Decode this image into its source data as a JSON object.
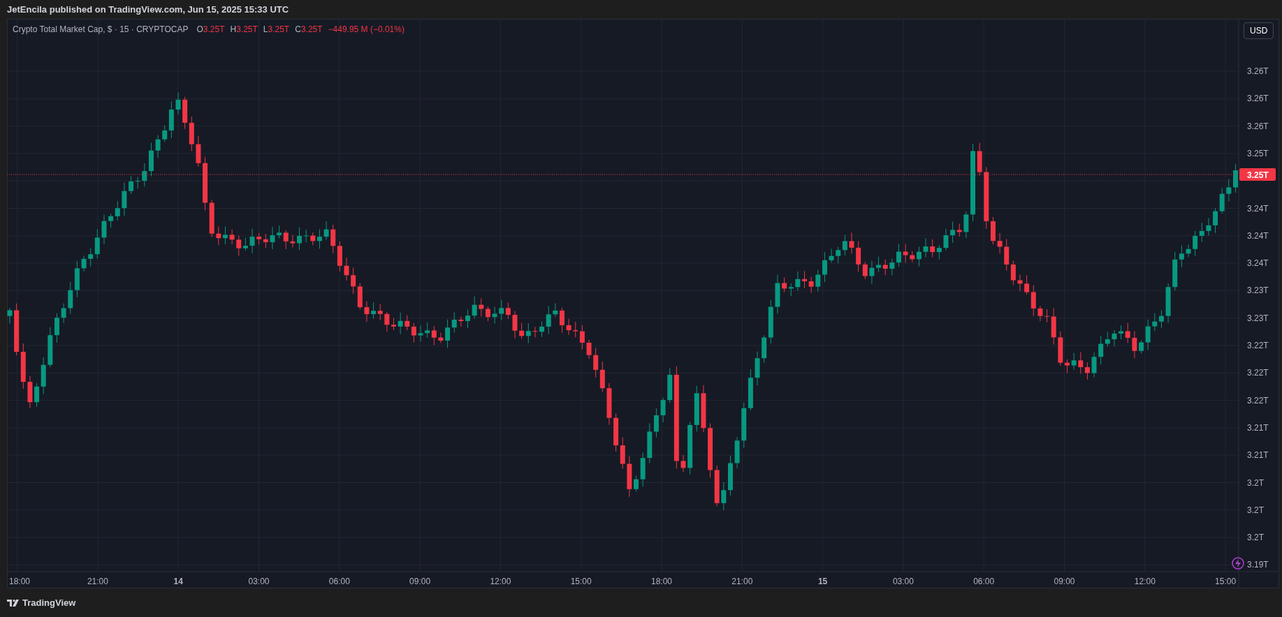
{
  "header": {
    "text": "JetEncila published on TradingView.com, Jun 15, 2025 15:33 UTC"
  },
  "legend": {
    "title": "Crypto Total Market Cap, $ · 15 · CRYPTOCAP",
    "ohlc": [
      {
        "label": "O",
        "value": "3.25T"
      },
      {
        "label": "H",
        "value": "3.25T"
      },
      {
        "label": "L",
        "value": "3.25T"
      },
      {
        "label": "C",
        "value": "3.25T"
      }
    ],
    "change": "−449.95 M (−0.01%)"
  },
  "currency_button": "USD",
  "price_axis": {
    "labels": [
      "3.26T",
      "3.26T",
      "3.26T",
      "3.25T",
      "3.24T",
      "3.24T",
      "3.24T",
      "3.23T",
      "3.23T",
      "3.22T",
      "3.22T",
      "3.22T",
      "3.21T",
      "3.21T",
      "3.2T",
      "3.2T",
      "3.2T",
      "3.19T"
    ],
    "current_price": "3.25T"
  },
  "time_axis": {
    "labels": [
      {
        "text": "18:00",
        "kind": "time"
      },
      {
        "text": "21:00",
        "kind": "time"
      },
      {
        "text": "14",
        "kind": "day"
      },
      {
        "text": "03:00",
        "kind": "time"
      },
      {
        "text": "06:00",
        "kind": "time"
      },
      {
        "text": "09:00",
        "kind": "time"
      },
      {
        "text": "12:00",
        "kind": "time"
      },
      {
        "text": "15:00",
        "kind": "time"
      },
      {
        "text": "18:00",
        "kind": "time"
      },
      {
        "text": "21:00",
        "kind": "time"
      },
      {
        "text": "15",
        "kind": "day"
      },
      {
        "text": "03:00",
        "kind": "time"
      },
      {
        "text": "06:00",
        "kind": "time"
      },
      {
        "text": "09:00",
        "kind": "time"
      },
      {
        "text": "12:00",
        "kind": "time"
      },
      {
        "text": "15:00",
        "kind": "time"
      }
    ]
  },
  "footer": {
    "brand": "TradingView"
  }
}
